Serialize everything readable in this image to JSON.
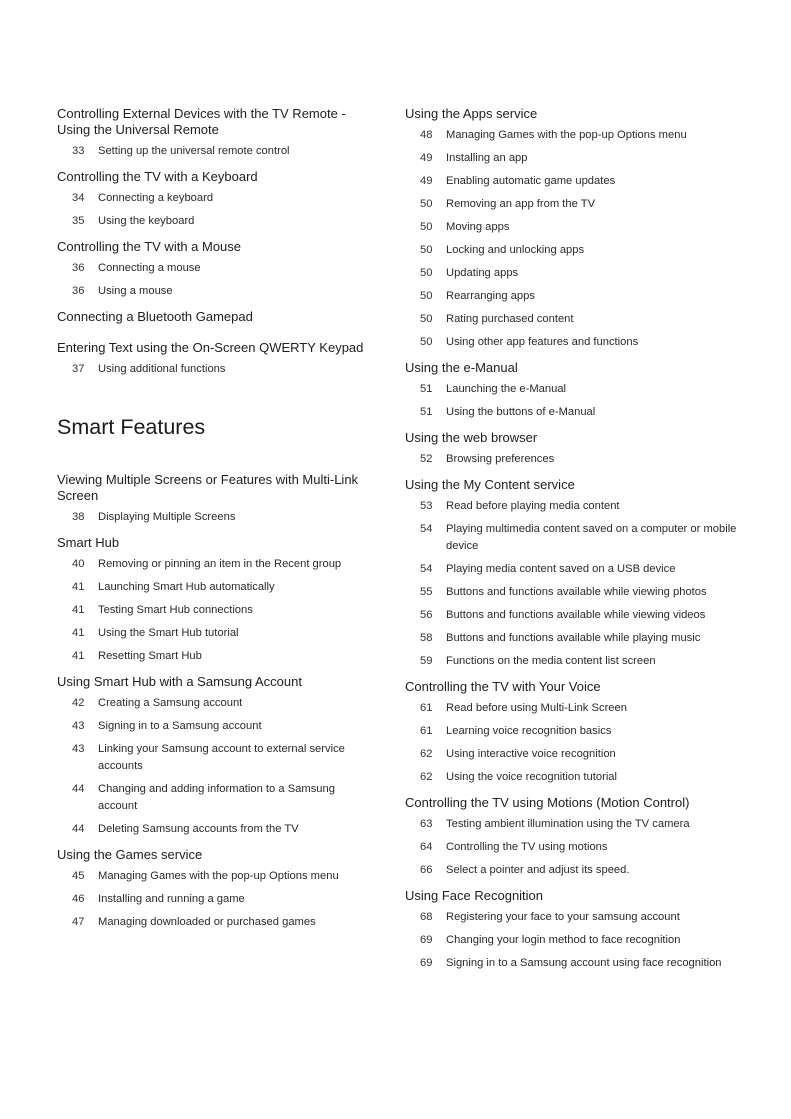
{
  "left_column": {
    "before_chapter": [
      {
        "title": "Controlling External Devices with the TV Remote - Using the Universal Remote",
        "items": [
          {
            "page": "33",
            "text": "Setting up the universal remote control"
          }
        ]
      },
      {
        "title": "Controlling the TV with a Keyboard",
        "items": [
          {
            "page": "34",
            "text": "Connecting a keyboard"
          },
          {
            "page": "35",
            "text": "Using the keyboard"
          }
        ]
      },
      {
        "title": "Controlling the TV with a Mouse",
        "items": [
          {
            "page": "36",
            "text": "Connecting a mouse"
          },
          {
            "page": "36",
            "text": "Using a mouse"
          }
        ]
      },
      {
        "title": "Connecting a Bluetooth Gamepad",
        "items": []
      },
      {
        "title": "Entering Text using the On-Screen QWERTY Keypad",
        "items": [
          {
            "page": "37",
            "text": "Using additional functions"
          }
        ]
      }
    ],
    "chapter_title": "Smart Features",
    "after_chapter": [
      {
        "title": "Viewing Multiple Screens or Features with Multi-Link Screen",
        "items": [
          {
            "page": "38",
            "text": "Displaying Multiple Screens"
          }
        ]
      },
      {
        "title": "Smart Hub",
        "items": [
          {
            "page": "40",
            "text": "Removing or pinning an item in the Recent group"
          },
          {
            "page": "41",
            "text": "Launching Smart Hub automatically"
          },
          {
            "page": "41",
            "text": "Testing Smart Hub connections"
          },
          {
            "page": "41",
            "text": "Using the Smart Hub tutorial"
          },
          {
            "page": "41",
            "text": "Resetting Smart Hub"
          }
        ]
      },
      {
        "title": "Using Smart Hub with a Samsung Account",
        "items": [
          {
            "page": "42",
            "text": "Creating a Samsung account"
          },
          {
            "page": "43",
            "text": "Signing in to a Samsung account"
          },
          {
            "page": "43",
            "text": "Linking your Samsung account to external service accounts"
          },
          {
            "page": "44",
            "text": "Changing and adding information to a Samsung account"
          },
          {
            "page": "44",
            "text": "Deleting Samsung accounts from the TV"
          }
        ]
      },
      {
        "title": "Using the Games service",
        "items": [
          {
            "page": "45",
            "text": "Managing Games with the pop-up Options menu"
          },
          {
            "page": "46",
            "text": "Installing and running a game"
          },
          {
            "page": "47",
            "text": "Managing downloaded or purchased games"
          }
        ]
      }
    ]
  },
  "right_column": [
    {
      "title": "Using the Apps service",
      "items": [
        {
          "page": "48",
          "text": "Managing Games with the pop-up Options menu"
        },
        {
          "page": "49",
          "text": "Installing an app"
        },
        {
          "page": "49",
          "text": "Enabling automatic game updates"
        },
        {
          "page": "50",
          "text": "Removing an app from the TV"
        },
        {
          "page": "50",
          "text": "Moving apps"
        },
        {
          "page": "50",
          "text": "Locking and unlocking apps"
        },
        {
          "page": "50",
          "text": "Updating apps"
        },
        {
          "page": "50",
          "text": "Rearranging apps"
        },
        {
          "page": "50",
          "text": "Rating purchased content"
        },
        {
          "page": "50",
          "text": "Using other app features and functions"
        }
      ]
    },
    {
      "title": "Using the e-Manual",
      "items": [
        {
          "page": "51",
          "text": "Launching the e-Manual"
        },
        {
          "page": "51",
          "text": "Using the buttons of e-Manual"
        }
      ]
    },
    {
      "title": "Using the web browser",
      "items": [
        {
          "page": "52",
          "text": "Browsing preferences"
        }
      ]
    },
    {
      "title": "Using the My Content service",
      "items": [
        {
          "page": "53",
          "text": "Read before playing media content"
        },
        {
          "page": "54",
          "text": "Playing multimedia content saved on a computer or mobile device"
        },
        {
          "page": "54",
          "text": "Playing media content saved on a USB device"
        },
        {
          "page": "55",
          "text": "Buttons and functions available while viewing photos"
        },
        {
          "page": "56",
          "text": "Buttons and functions available while viewing videos"
        },
        {
          "page": "58",
          "text": "Buttons and functions available while playing music"
        },
        {
          "page": "59",
          "text": "Functions on the media content list screen"
        }
      ]
    },
    {
      "title": "Controlling the TV with Your Voice",
      "items": [
        {
          "page": "61",
          "text": "Read before using Multi-Link Screen"
        },
        {
          "page": "61",
          "text": "Learning voice recognition basics"
        },
        {
          "page": "62",
          "text": "Using interactive voice recognition"
        },
        {
          "page": "62",
          "text": "Using the voice recognition tutorial"
        }
      ]
    },
    {
      "title": "Controlling the TV using Motions (Motion Control)",
      "items": [
        {
          "page": "63",
          "text": "Testing ambient illumination using the TV camera"
        },
        {
          "page": "64",
          "text": "Controlling the TV using motions"
        },
        {
          "page": "66",
          "text": "Select a pointer and adjust its speed."
        }
      ]
    },
    {
      "title": "Using Face Recognition",
      "items": [
        {
          "page": "68",
          "text": "Registering your face to your samsung account"
        },
        {
          "page": "69",
          "text": "Changing your login method to face recognition"
        },
        {
          "page": "69",
          "text": "Signing in to a Samsung account using face recognition"
        }
      ]
    }
  ]
}
